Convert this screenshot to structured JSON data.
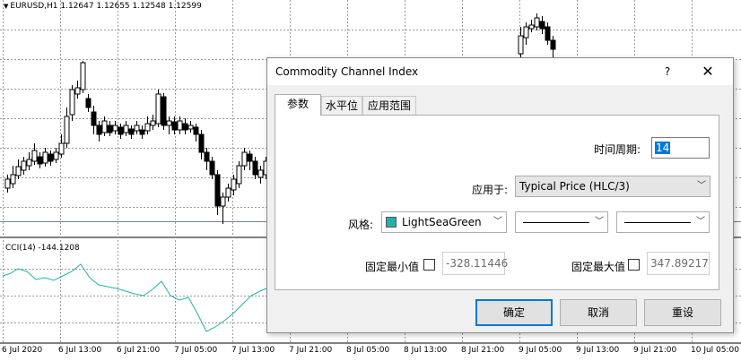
{
  "chart": {
    "symbol_line": "EURUSD,H1  1.12647  1.12655  1.12548  1.12599",
    "indicator_label": "CCI(14) -144.1208",
    "time_labels": [
      "6 Jul 2020",
      "6 Jul 13:00",
      "6 Jul 21:00",
      "7 Jul 05:00",
      "7 Jul 13:00",
      "7 Jul 21:00",
      "8 Jul 05:00",
      "8 Jul 13:00",
      "8 Jul 21:00",
      "9 Jul 05:00",
      "9 Jul 13:00",
      "9 Jul 21:00",
      "10 Jul 05:00"
    ],
    "cci_color": "#20b2aa"
  },
  "dialog": {
    "title": "Commodity Channel Index",
    "help_label": "?",
    "close_label": "✕",
    "tabs": [
      "参数",
      "水平位",
      "应用范围"
    ],
    "period_label": "时间周期:",
    "period_value": "14",
    "apply_label": "应用于:",
    "apply_value": "Typical Price (HLC/3)",
    "style_label": "风格:",
    "color_name": "LightSeaGreen",
    "color_hex": "#20b2aa",
    "fixed_min_label": "固定最小值",
    "fixed_min_value": "-328.11446",
    "fixed_max_label": "固定最大值",
    "fixed_max_value": "347.89217",
    "ok_label": "确定",
    "cancel_label": "取消",
    "reset_label": "重设"
  }
}
